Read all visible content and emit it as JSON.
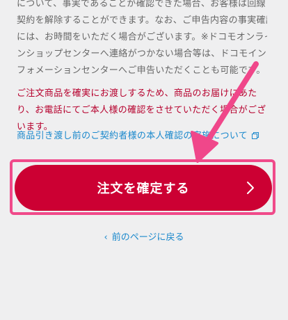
{
  "notice": {
    "lines": [
      "について、事実であることが確認できた場合、お客様は回線",
      "契約を解除することができます。なお、ご申告内容の事実確認",
      "には、お時間をいただく場合がございます。※ドコモオンライ",
      "ンショップセンターへ連絡がつかない場合等は、ドコモイン",
      "フォメーションセンターへご申告いただくことも可能です。"
    ]
  },
  "delivery_notice": {
    "lines": [
      "ご注文商品を確実にお渡しするため、商品のお届けにあた",
      "り、お電話にてご本人様の確認をさせていただく場合がござ",
      "います。"
    ]
  },
  "identity_link": {
    "label": "商品引き渡し前のご契約者様の本人確認の実施について",
    "icon": "external-window-icon"
  },
  "confirm_button": {
    "label": "注文を確定する",
    "icon": "chevron-right-icon"
  },
  "back_link": {
    "label": "前のページに戻る",
    "icon": "chevron-left-icon"
  },
  "colors": {
    "background": "#efeff0",
    "accent_red": "#cc0033",
    "notice_red": "#b6002d",
    "link_blue": "#1a88cc",
    "highlight_pink": "#f04a8a"
  }
}
